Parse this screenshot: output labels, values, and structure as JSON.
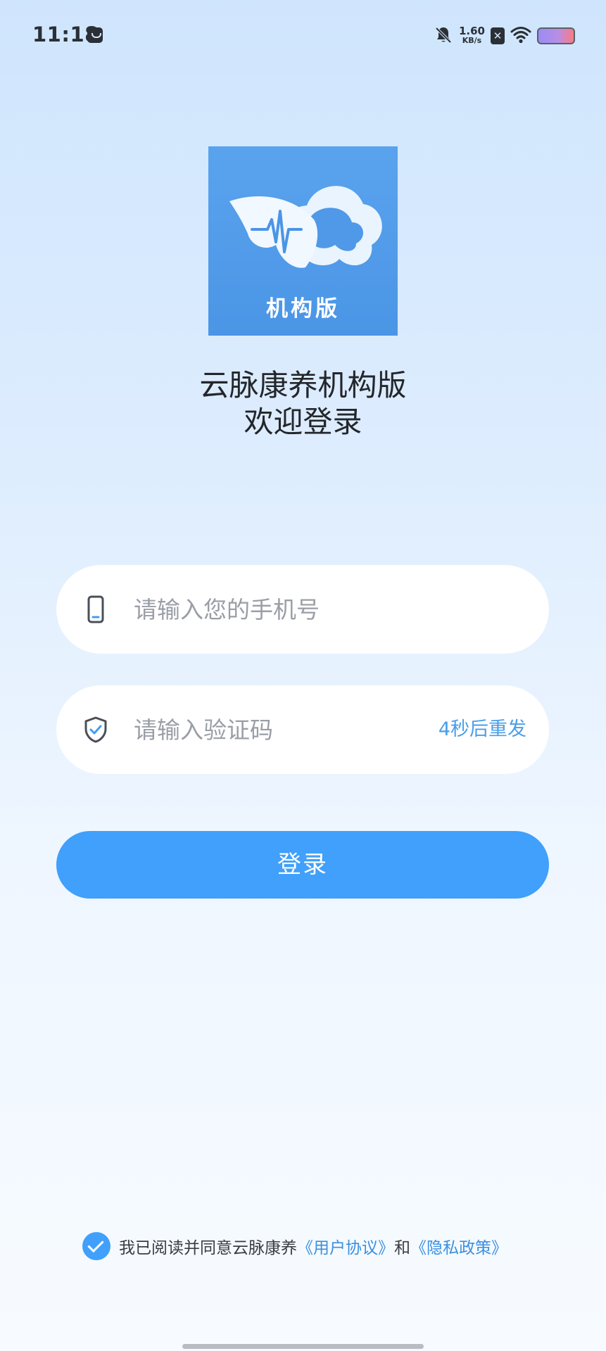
{
  "status_bar": {
    "time": "11:18",
    "net_speed_value": "1.60",
    "net_speed_unit": "KB/s",
    "sim_badge": "✕",
    "icons": [
      "message-icon",
      "mute-bell-icon",
      "sim-x-icon",
      "wifi-icon",
      "battery-icon"
    ]
  },
  "logo": {
    "text": "机构版",
    "bg_color": "#4b95e6"
  },
  "header": {
    "app_name": "云脉康养机构版",
    "welcome": "欢迎登录"
  },
  "form": {
    "phone_placeholder": "请输入您的手机号",
    "phone_value": "",
    "code_placeholder": "请输入验证码",
    "code_value": "",
    "resend_label": "4秒后重发",
    "login_label": "登录"
  },
  "agreement": {
    "checked": true,
    "prefix": "我已阅读并同意云脉康养",
    "user_agreement": "《用户协议》",
    "conjunction": "和",
    "privacy_policy": "《隐私政策》"
  },
  "colors": {
    "accent": "#40a0fb",
    "link": "#3b8fdf",
    "text_dark": "#23262b",
    "placeholder": "#9a9ea6"
  }
}
